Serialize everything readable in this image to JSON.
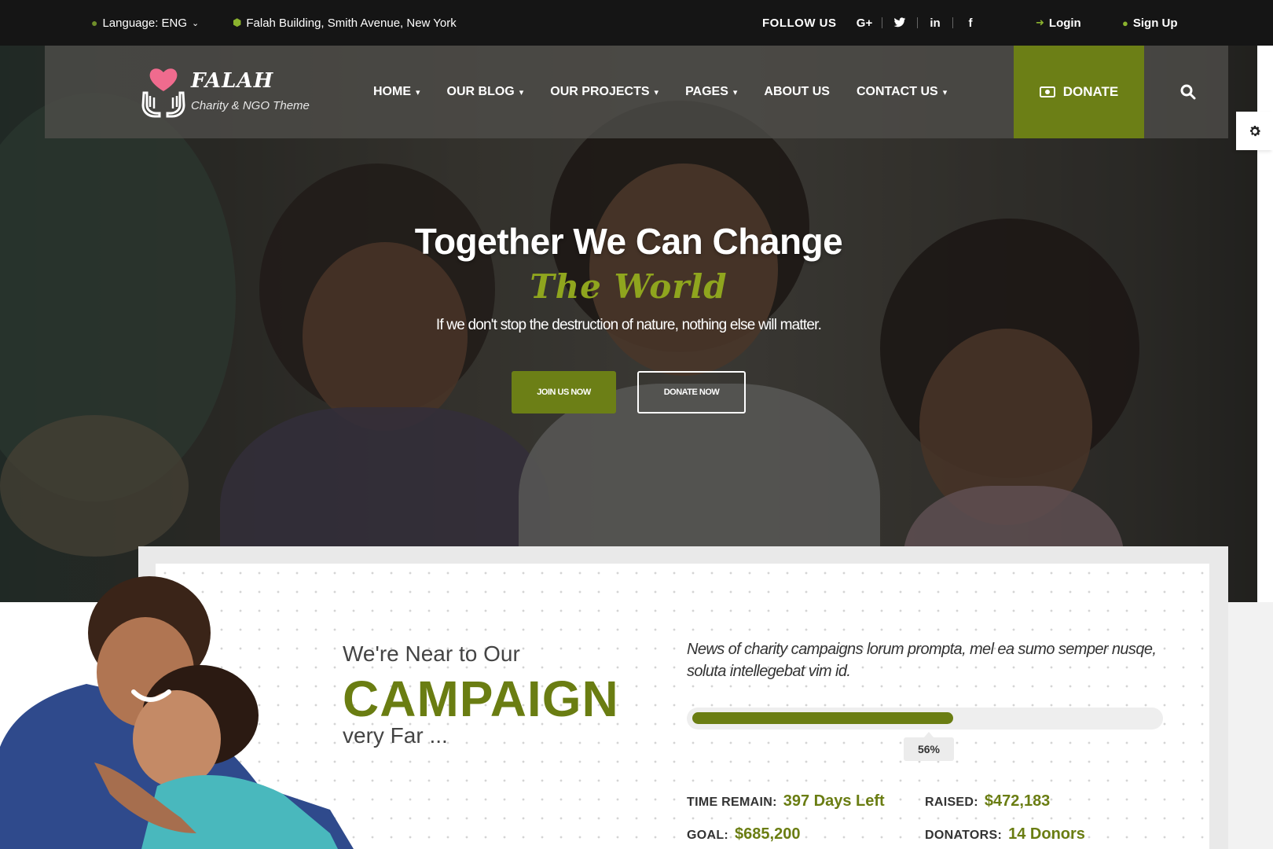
{
  "topbar": {
    "language": "Language: ENG",
    "address": "Falah Building, Smith Avenue, New York",
    "follow_us": "FOLLOW US",
    "socials": [
      "G+",
      "twitter-icon",
      "in",
      "f"
    ],
    "login": "Login",
    "signup": "Sign Up"
  },
  "brand": {
    "name": "FALAH",
    "tagline": "Charity & NGO Theme"
  },
  "nav": {
    "items": [
      {
        "label": "HOME",
        "has_dropdown": true
      },
      {
        "label": "OUR BLOG",
        "has_dropdown": true
      },
      {
        "label": "OUR PROJECTS",
        "has_dropdown": true
      },
      {
        "label": "PAGES",
        "has_dropdown": true
      },
      {
        "label": "ABOUT US",
        "has_dropdown": false
      },
      {
        "label": "CONTACT US",
        "has_dropdown": true
      }
    ],
    "donate": "DONATE"
  },
  "hero": {
    "headline": "Together We Can Change",
    "subhead": "The World",
    "tagline": "If we don't stop the destruction of nature, nothing else will matter.",
    "join_button": "JOIN US NOW",
    "donate_button": "DONATE NOW"
  },
  "campaign": {
    "near": "We're Near to Our",
    "title": "CAMPAIGN",
    "far": "very Far ...",
    "news": "News of charity campaigns lorum prompta, mel ea sumo semper nusqe, soluta intellegebat vim id.",
    "progress": 0.56,
    "progress_label": "56%",
    "stats": {
      "time_remain_label": "TIME REMAIN:",
      "time_remain_value": "397 Days Left",
      "raised_label": "RAISED:",
      "raised_value": "$472,183",
      "goal_label": "GOAL:",
      "goal_value": "$685,200",
      "donators_label": "DONATORS:",
      "donators_value": "14 Donors"
    }
  },
  "colors": {
    "accent": "#6c7f16",
    "topbar": "#151515",
    "heart": "#f06b8e"
  }
}
